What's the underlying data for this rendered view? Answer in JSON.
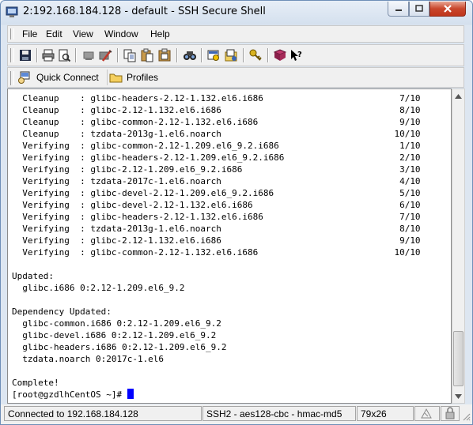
{
  "window": {
    "title": "2:192.168.184.128 - default - SSH Secure Shell",
    "colors": {
      "close_button": "#c9462c",
      "cursor": "#0000ff"
    }
  },
  "menu": {
    "items": [
      {
        "label": "File"
      },
      {
        "label": "Edit"
      },
      {
        "label": "View"
      },
      {
        "label": "Window"
      },
      {
        "label": "Help"
      }
    ]
  },
  "toolbar": {
    "icons": [
      "save-icon",
      "print-icon",
      "print-preview-icon",
      "disconnect-icon",
      "edit-profile-icon",
      "copy-icon",
      "paste-icon",
      "paste-special-icon",
      "find-icon",
      "settings-icon",
      "file-transfer-icon",
      "key-icon",
      "help-book-icon",
      "context-help-icon"
    ]
  },
  "quickbar": {
    "quick_connect": "Quick Connect",
    "profiles": "Profiles"
  },
  "terminal": {
    "lines": [
      "  Cleanup    : glibc-headers-2.12-1.132.el6.i686                          7/10",
      "  Cleanup    : glibc-2.12-1.132.el6.i686                                  8/10",
      "  Cleanup    : glibc-common-2.12-1.132.el6.i686                           9/10",
      "  Cleanup    : tzdata-2013g-1.el6.noarch                                 10/10",
      "  Verifying  : glibc-common-2.12-1.209.el6_9.2.i686                       1/10",
      "  Verifying  : glibc-headers-2.12-1.209.el6_9.2.i686                      2/10",
      "  Verifying  : glibc-2.12-1.209.el6_9.2.i686                              3/10",
      "  Verifying  : tzdata-2017c-1.el6.noarch                                  4/10",
      "  Verifying  : glibc-devel-2.12-1.209.el6_9.2.i686                        5/10",
      "  Verifying  : glibc-devel-2.12-1.132.el6.i686                            6/10",
      "  Verifying  : glibc-headers-2.12-1.132.el6.i686                          7/10",
      "  Verifying  : tzdata-2013g-1.el6.noarch                                  8/10",
      "  Verifying  : glibc-2.12-1.132.el6.i686                                  9/10",
      "  Verifying  : glibc-common-2.12-1.132.el6.i686                          10/10",
      "",
      "Updated:",
      "  glibc.i686 0:2.12-1.209.el6_9.2",
      "",
      "Dependency Updated:",
      "  glibc-common.i686 0:2.12-1.209.el6_9.2",
      "  glibc-devel.i686 0:2.12-1.209.el6_9.2",
      "  glibc-headers.i686 0:2.12-1.209.el6_9.2",
      "  tzdata.noarch 0:2017c-1.el6",
      "",
      "Complete!"
    ],
    "prompt": "[root@gzdlhCentOS ~]# "
  },
  "status": {
    "connection": "Connected to 192.168.184.128",
    "cipher": "SSH2 - aes128-cbc - hmac-md5",
    "size": "79x26"
  }
}
